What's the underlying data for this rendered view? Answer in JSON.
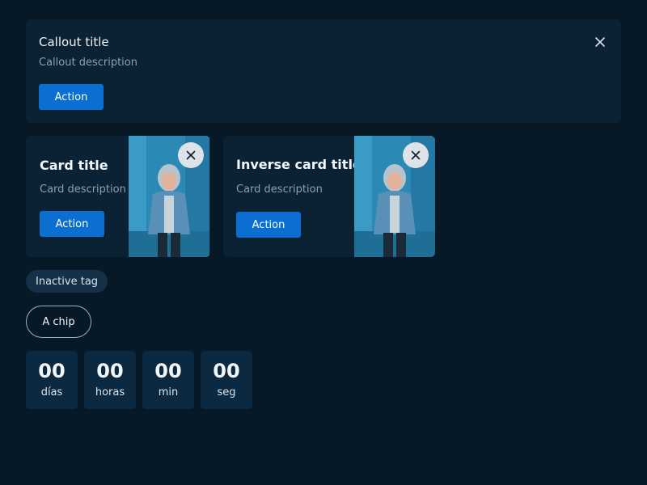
{
  "callout": {
    "title": "Callout title",
    "description": "Callout description",
    "action_label": "Action"
  },
  "cards": [
    {
      "title": "Card title",
      "description": "Card description",
      "action_label": "Action"
    },
    {
      "title": "Inverse card title",
      "description": "Card description",
      "action_label": "Action"
    }
  ],
  "tag": {
    "label": "Inactive tag"
  },
  "chip": {
    "label": "A chip"
  },
  "countdown": [
    {
      "value": "00",
      "unit": "días"
    },
    {
      "value": "00",
      "unit": "horas"
    },
    {
      "value": "00",
      "unit": "min"
    },
    {
      "value": "00",
      "unit": "seg"
    }
  ],
  "colors": {
    "background": "#071826",
    "surface": "#0b2234",
    "primary_button": "#0b6fd1",
    "muted_text": "#8ea0af",
    "tag_background": "#153049",
    "countdown_background": "#0b2a42"
  },
  "icons": {
    "close": "close-icon",
    "image_close": "close-icon"
  }
}
